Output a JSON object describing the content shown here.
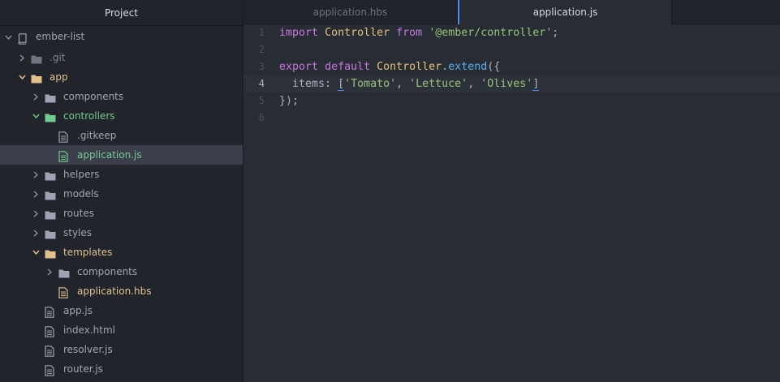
{
  "sidebar": {
    "title": "Project",
    "tree": [
      {
        "label": "ember-list",
        "kind": "repo",
        "depth": 0,
        "expanded": true,
        "color": "default"
      },
      {
        "label": ".git",
        "kind": "folder",
        "depth": 1,
        "expanded": false,
        "color": "muted"
      },
      {
        "label": "app",
        "kind": "folder",
        "depth": 1,
        "expanded": true,
        "color": "yellow"
      },
      {
        "label": "components",
        "kind": "folder",
        "depth": 2,
        "expanded": false,
        "color": "default"
      },
      {
        "label": "controllers",
        "kind": "folder",
        "depth": 2,
        "expanded": true,
        "color": "green"
      },
      {
        "label": ".gitkeep",
        "kind": "file",
        "depth": 3,
        "color": "default"
      },
      {
        "label": "application.js",
        "kind": "file",
        "depth": 3,
        "color": "green",
        "selected": true
      },
      {
        "label": "helpers",
        "kind": "folder",
        "depth": 2,
        "expanded": false,
        "color": "default"
      },
      {
        "label": "models",
        "kind": "folder",
        "depth": 2,
        "expanded": false,
        "color": "default"
      },
      {
        "label": "routes",
        "kind": "folder",
        "depth": 2,
        "expanded": false,
        "color": "default"
      },
      {
        "label": "styles",
        "kind": "folder",
        "depth": 2,
        "expanded": false,
        "color": "default"
      },
      {
        "label": "templates",
        "kind": "folder",
        "depth": 2,
        "expanded": true,
        "color": "yellow"
      },
      {
        "label": "components",
        "kind": "folder",
        "depth": 3,
        "expanded": false,
        "color": "default"
      },
      {
        "label": "application.hbs",
        "kind": "file",
        "depth": 3,
        "color": "yellow"
      },
      {
        "label": "app.js",
        "kind": "file",
        "depth": 2,
        "color": "default"
      },
      {
        "label": "index.html",
        "kind": "file",
        "depth": 2,
        "color": "default"
      },
      {
        "label": "resolver.js",
        "kind": "file",
        "depth": 2,
        "color": "default"
      },
      {
        "label": "router.js",
        "kind": "file",
        "depth": 2,
        "color": "default"
      }
    ]
  },
  "tabs": [
    {
      "label": "application.hbs",
      "active": false
    },
    {
      "label": "application.js",
      "active": true
    }
  ],
  "editor": {
    "cursor_line": 4,
    "lines": [
      {
        "num": "1",
        "tokens": [
          {
            "t": "import",
            "c": "kw"
          },
          {
            "t": " "
          },
          {
            "t": "Controller",
            "c": "cls"
          },
          {
            "t": " "
          },
          {
            "t": "from",
            "c": "kw"
          },
          {
            "t": " "
          },
          {
            "t": "'@ember/controller'",
            "c": "str"
          },
          {
            "t": ";",
            "c": "pun"
          }
        ]
      },
      {
        "num": "2",
        "tokens": []
      },
      {
        "num": "3",
        "tokens": [
          {
            "t": "export",
            "c": "kw"
          },
          {
            "t": " "
          },
          {
            "t": "default",
            "c": "kw"
          },
          {
            "t": " "
          },
          {
            "t": "Controller",
            "c": "cls"
          },
          {
            "t": ".",
            "c": "pun"
          },
          {
            "t": "extend",
            "c": "fn"
          },
          {
            "t": "({",
            "c": "pun"
          }
        ]
      },
      {
        "num": "4",
        "tokens": [
          {
            "t": "  items",
            "c": "prop"
          },
          {
            "t": ": ",
            "c": "pun"
          },
          {
            "t": "[",
            "c": "pun",
            "match": true
          },
          {
            "t": "'Tomato'",
            "c": "str"
          },
          {
            "t": ", ",
            "c": "pun"
          },
          {
            "t": "'Lettuce'",
            "c": "str"
          },
          {
            "t": ", ",
            "c": "pun"
          },
          {
            "t": "'Olives'",
            "c": "str"
          },
          {
            "t": "]",
            "c": "pun",
            "match": true
          }
        ]
      },
      {
        "num": "5",
        "tokens": [
          {
            "t": "});",
            "c": "pun"
          }
        ]
      },
      {
        "num": "6",
        "tokens": []
      }
    ]
  },
  "colors": {
    "green": "#73c990",
    "yellow": "#e2c08d",
    "muted": "#7f848e",
    "accent": "#528bff"
  }
}
